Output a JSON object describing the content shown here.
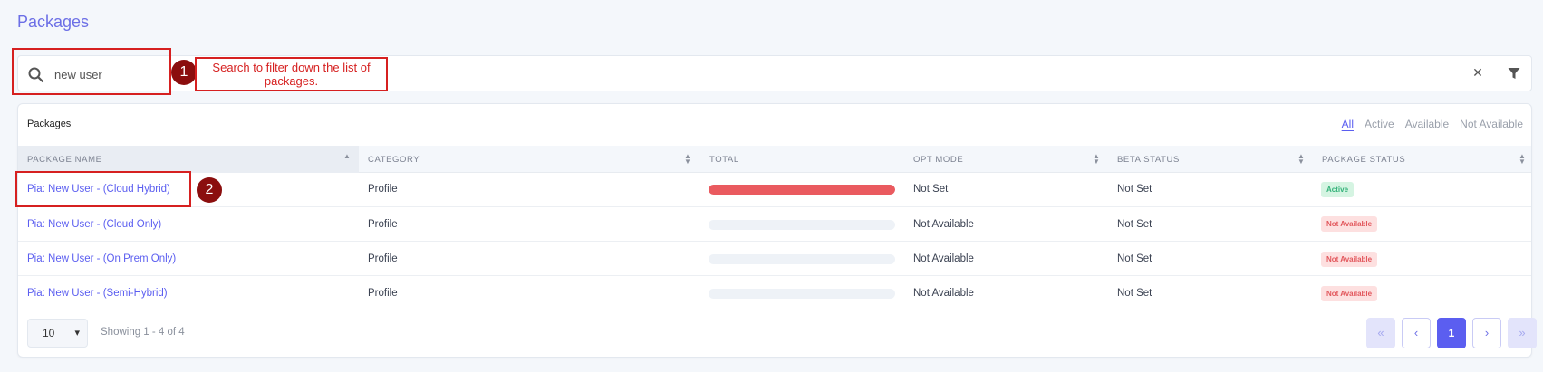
{
  "page": {
    "title": "Packages"
  },
  "search": {
    "value": "new user",
    "placeholder": ""
  },
  "callouts": [
    {
      "number": "1",
      "text": "Search to filter down the list of packages."
    },
    {
      "number": "2"
    }
  ],
  "card": {
    "title": "Packages",
    "filters": [
      {
        "label": "All",
        "active": true
      },
      {
        "label": "Active",
        "active": false
      },
      {
        "label": "Available",
        "active": false
      },
      {
        "label": "Not Available",
        "active": false
      }
    ]
  },
  "table": {
    "columns": [
      "PACKAGE NAME",
      "CATEGORY",
      "TOTAL",
      "OPT MODE",
      "BETA STATUS",
      "PACKAGE STATUS"
    ],
    "rows": [
      {
        "name": "Pia: New User - (Cloud Hybrid)",
        "category": "Profile",
        "total": 1.0,
        "opt_mode": "Not Set",
        "beta_status": "Not Set",
        "package_status": "Active"
      },
      {
        "name": "Pia: New User - (Cloud Only)",
        "category": "Profile",
        "total": 0.0,
        "opt_mode": "Not Available",
        "beta_status": "Not Set",
        "package_status": "Not Available"
      },
      {
        "name": "Pia: New User - (On Prem Only)",
        "category": "Profile",
        "total": 0.0,
        "opt_mode": "Not Available",
        "beta_status": "Not Set",
        "package_status": "Not Available"
      },
      {
        "name": "Pia: New User - (Semi-Hybrid)",
        "category": "Profile",
        "total": 0.0,
        "opt_mode": "Not Available",
        "beta_status": "Not Set",
        "package_status": "Not Available"
      }
    ]
  },
  "footer": {
    "per_page": "10",
    "showing": "Showing 1 - 4 of 4",
    "pager": {
      "first": "«",
      "prev": "‹",
      "current": "1",
      "next": "›",
      "last": "»"
    }
  },
  "icons": {
    "search": "search-icon",
    "clear": "close-icon",
    "filter": "filter-icon"
  },
  "colors": {
    "accent": "#5b5ef0",
    "bar_fill": "#ea5a5f",
    "callout": "#d62020",
    "badge_active_bg": "#d5f4e2",
    "badge_na_bg": "#fde0e0"
  }
}
